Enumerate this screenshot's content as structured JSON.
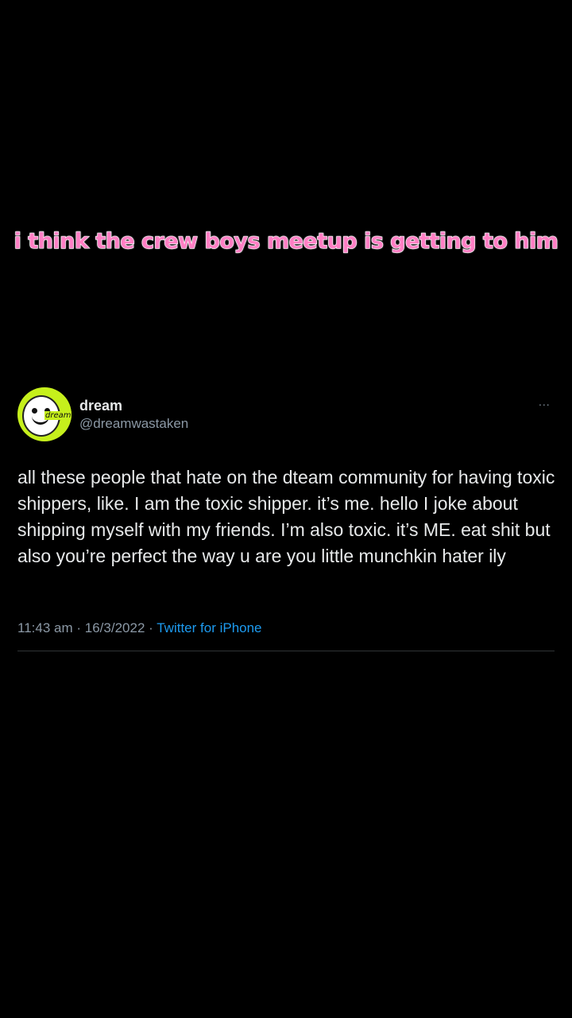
{
  "caption": "i think the crew boys meetup is getting to him",
  "tweet": {
    "avatar_label": "dream",
    "display_name": "dream",
    "handle": "@dreamwastaken",
    "more_icon": "...",
    "text": "all these people that hate on the dteam community for having toxic shippers, like. I am the toxic shipper. it’s me. hello I joke about shipping myself with my friends. I’m also toxic. it’s ME. eat shit but also you’re perfect the way u are you little munchkin hater ily",
    "time": "11:43 am",
    "separator": "·",
    "date": "16/3/2022",
    "source": "Twitter for iPhone"
  },
  "colors": {
    "background": "#000000",
    "caption": "#ff7fc4",
    "avatar_bg": "#c6f01c",
    "text": "#e7e9ea",
    "muted": "#8b98a5",
    "link": "#1d9bf0"
  }
}
